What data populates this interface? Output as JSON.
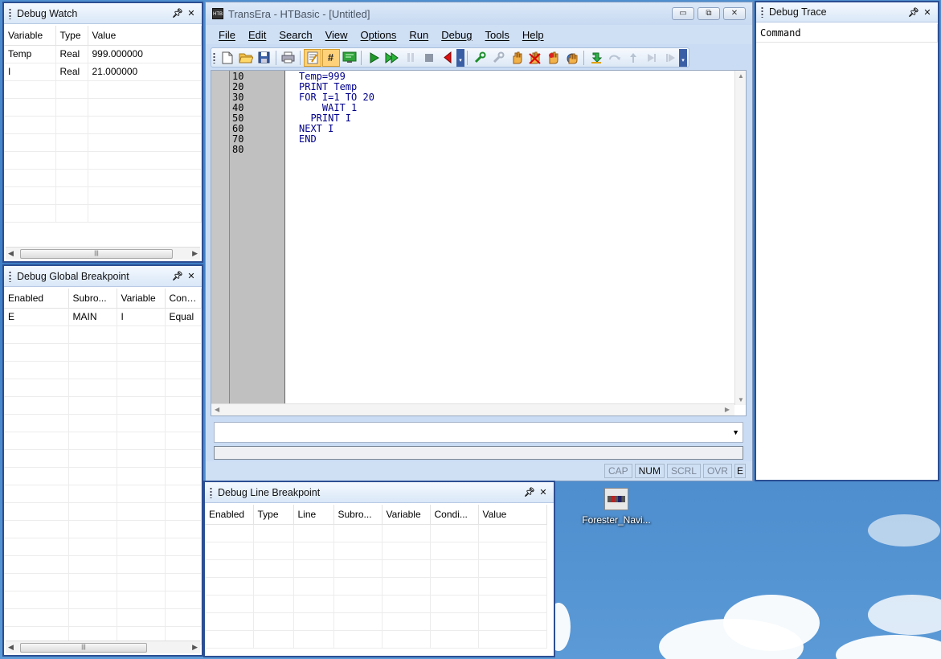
{
  "debug_watch": {
    "title": "Debug Watch",
    "columns": [
      "Variable",
      "Type",
      "Value"
    ],
    "rows": [
      [
        "Temp",
        "Real",
        "999.000000"
      ],
      [
        "I",
        "Real",
        "21.000000"
      ]
    ]
  },
  "debug_global_breakpoint": {
    "title": "Debug Global Breakpoint",
    "columns": [
      "Enabled",
      "Subro...",
      "Variable",
      "Condi..."
    ],
    "rows": [
      [
        "E",
        "MAIN",
        "I",
        "Equal"
      ]
    ]
  },
  "debug_line_breakpoint": {
    "title": "Debug Line Breakpoint",
    "columns": [
      "Enabled",
      "Type",
      "Line",
      "Subro...",
      "Variable",
      "Condi...",
      "Value"
    ]
  },
  "debug_trace": {
    "title": "Debug Trace",
    "columns": [
      "Command"
    ]
  },
  "main_window": {
    "title": "TransEra - HTBasic - [Untitled]",
    "app_icon_text": "HTB",
    "menu": [
      "File",
      "Edit",
      "Search",
      "View",
      "Options",
      "Run",
      "Debug",
      "Tools",
      "Help"
    ],
    "line_numbers": [
      "10",
      "20",
      "30",
      "40",
      "50",
      "60",
      "70",
      "80"
    ],
    "code_lines": [
      "Temp=999",
      "PRINT Temp",
      "FOR I=1 TO 20",
      "    WAIT 1",
      "  PRINT I",
      "NEXT I",
      "END",
      ""
    ],
    "status": [
      "CAP",
      "NUM",
      "SCRL",
      "OVR",
      "E"
    ],
    "status_active": "NUM"
  },
  "desktop": {
    "icon_label": "Forester_Navi..."
  },
  "icons": {
    "pin": "pin-icon",
    "close": "close-icon"
  }
}
